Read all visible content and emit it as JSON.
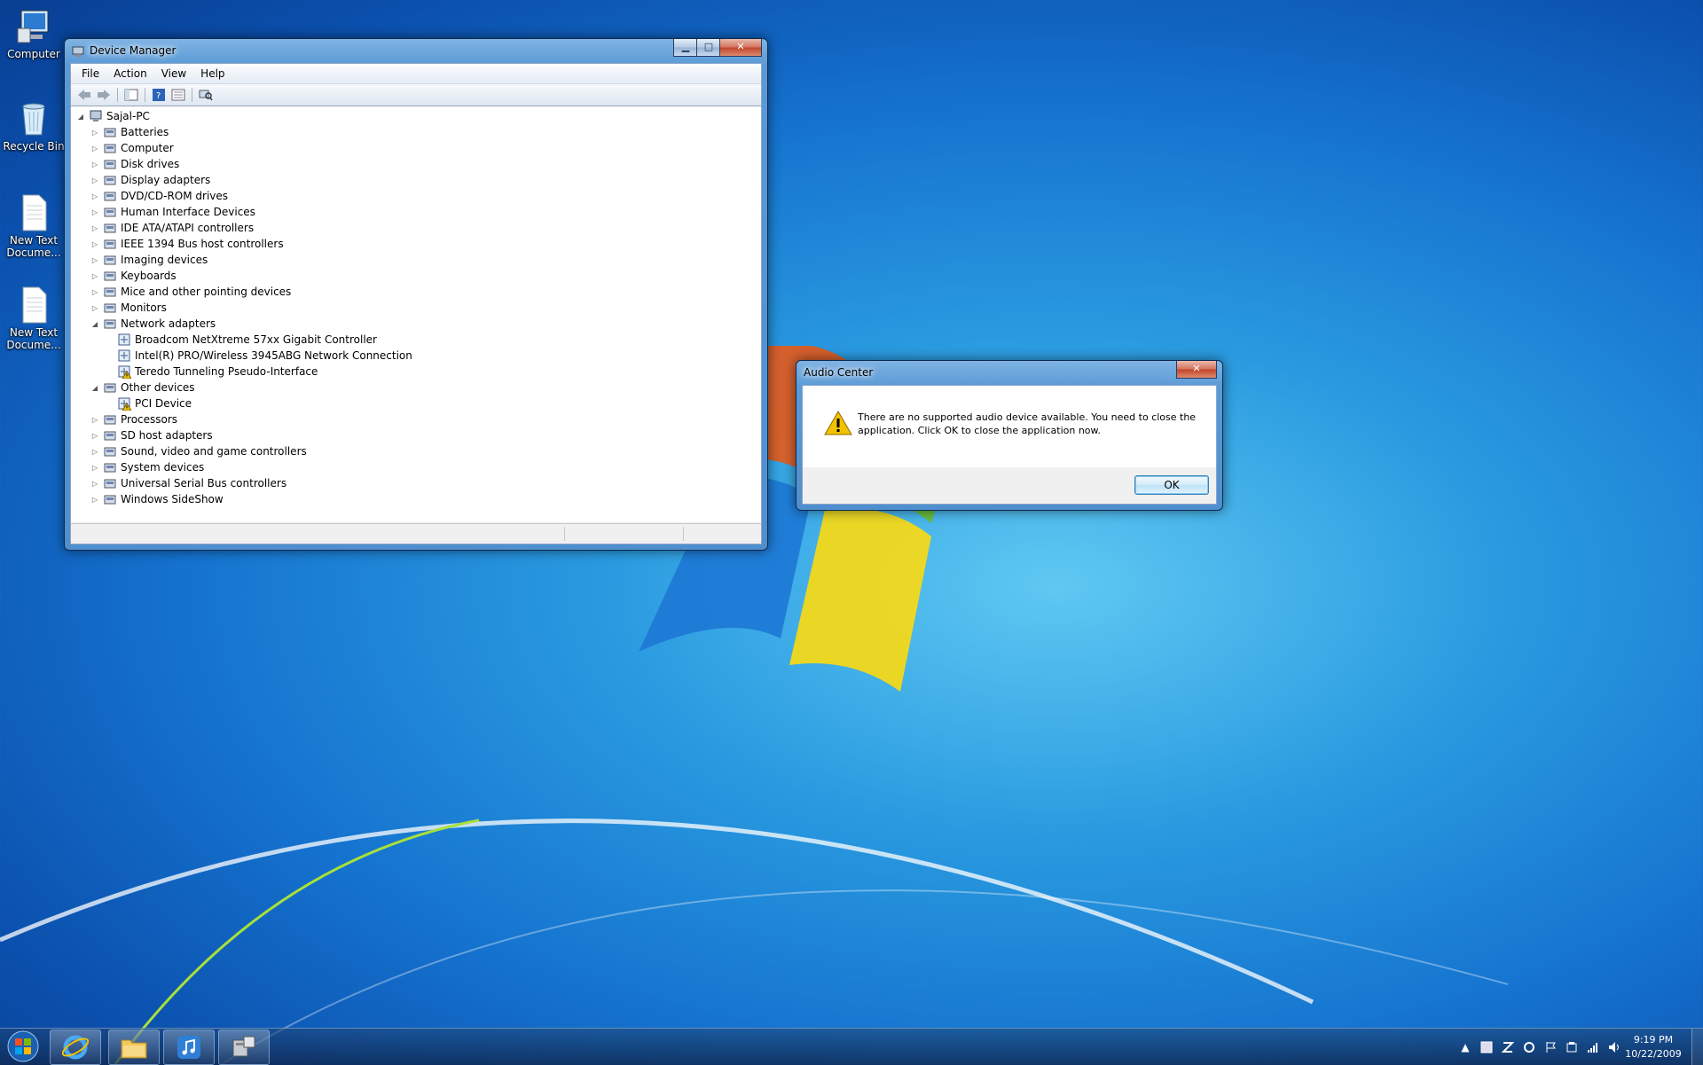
{
  "desktop": {
    "icons": [
      {
        "label": "Computer",
        "icon": "computer-icon"
      },
      {
        "label": "Recycle Bin",
        "icon": "recycle-bin-icon"
      },
      {
        "label": "New Text Docume...",
        "icon": "text-document-icon"
      },
      {
        "label": "New Text Docume...",
        "icon": "text-document-icon"
      }
    ]
  },
  "device_manager": {
    "title": "Device Manager",
    "menu": [
      "File",
      "Action",
      "View",
      "Help"
    ],
    "toolbar": [
      "back-icon",
      "forward-icon",
      "show-hide-tree-icon",
      "help-icon",
      "properties-icon",
      "scan-hardware-icon"
    ],
    "root": "Sajal-PC",
    "categories": [
      {
        "label": "Batteries",
        "expanded": false
      },
      {
        "label": "Computer",
        "expanded": false
      },
      {
        "label": "Disk drives",
        "expanded": false
      },
      {
        "label": "Display adapters",
        "expanded": false
      },
      {
        "label": "DVD/CD-ROM drives",
        "expanded": false
      },
      {
        "label": "Human Interface Devices",
        "expanded": false
      },
      {
        "label": "IDE ATA/ATAPI controllers",
        "expanded": false
      },
      {
        "label": "IEEE 1394 Bus host controllers",
        "expanded": false
      },
      {
        "label": "Imaging devices",
        "expanded": false
      },
      {
        "label": "Keyboards",
        "expanded": false
      },
      {
        "label": "Mice and other pointing devices",
        "expanded": false
      },
      {
        "label": "Monitors",
        "expanded": false
      },
      {
        "label": "Network adapters",
        "expanded": true,
        "children": [
          {
            "label": "Broadcom NetXtreme 57xx Gigabit Controller",
            "warning": false
          },
          {
            "label": "Intel(R) PRO/Wireless 3945ABG Network Connection",
            "warning": false
          },
          {
            "label": "Teredo Tunneling Pseudo-Interface",
            "warning": true
          }
        ]
      },
      {
        "label": "Other devices",
        "expanded": true,
        "children": [
          {
            "label": "PCI Device",
            "warning": true
          }
        ]
      },
      {
        "label": "Processors",
        "expanded": false
      },
      {
        "label": "SD host adapters",
        "expanded": false
      },
      {
        "label": "Sound, video and game controllers",
        "expanded": false
      },
      {
        "label": "System devices",
        "expanded": false
      },
      {
        "label": "Universal Serial Bus controllers",
        "expanded": false
      },
      {
        "label": "Windows SideShow",
        "expanded": false
      }
    ]
  },
  "audio_center": {
    "title": "Audio Center",
    "message": "There are no supported audio device available. You need to close the application. Click OK to close the application now.",
    "ok_label": "OK"
  },
  "taskbar": {
    "pinned": [
      "windows-start-icon",
      "internet-explorer-icon",
      "windows-explorer-icon",
      "itunes-icon",
      "device-manager-icon"
    ],
    "tray_icons": [
      "show-hidden-icons-icon",
      "tray-app-icon",
      "tray-app-icon",
      "tray-app-icon",
      "action-center-flag-icon",
      "tray-app-icon",
      "network-signal-icon",
      "volume-icon"
    ],
    "time": "9:19 PM",
    "date": "10/22/2009"
  },
  "colors": {
    "desktop_blue": "#1573cf",
    "glass_border": "#0d2a52",
    "selection_blue": "#3c7fb1",
    "warning_yellow": "#f2c200"
  }
}
